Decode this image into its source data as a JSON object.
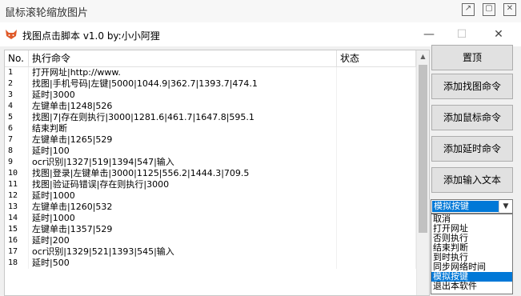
{
  "viewer": {
    "title": "鼠标滚轮缩放图片"
  },
  "window": {
    "title": "找图点击脚本 v1.0 by:小小阿狸",
    "controls": {
      "minimize": "—",
      "maximize": "☐",
      "close": "✕"
    }
  },
  "table": {
    "headers": [
      "No.",
      "执行命令",
      "状态"
    ],
    "rows": [
      {
        "no": "1",
        "cmd": "打开网址|http://www.                         ",
        "status": ""
      },
      {
        "no": "2",
        "cmd": "找图|手机号码|左键|5000|1044.9|362.7|1393.7|474.1",
        "status": ""
      },
      {
        "no": "3",
        "cmd": "延时|3000",
        "status": ""
      },
      {
        "no": "4",
        "cmd": "左键单击|1248|526",
        "status": ""
      },
      {
        "no": "5",
        "cmd": "找图|7|存在则执行|3000|1281.6|461.7|1647.8|595.1",
        "status": ""
      },
      {
        "no": "6",
        "cmd": "结束判断",
        "status": ""
      },
      {
        "no": "7",
        "cmd": "左键单击|1265|529",
        "status": ""
      },
      {
        "no": "8",
        "cmd": "延时|100",
        "status": ""
      },
      {
        "no": "9",
        "cmd": "ocr识别|1327|519|1394|547|输入",
        "status": ""
      },
      {
        "no": "10",
        "cmd": "找图|登录|左键单击|3000|1125|556.2|1444.3|709.5",
        "status": ""
      },
      {
        "no": "11",
        "cmd": "找图|验证码错误|存在则执行|3000",
        "status": ""
      },
      {
        "no": "12",
        "cmd": "延时|1000",
        "status": ""
      },
      {
        "no": "13",
        "cmd": "左键单击|1260|532",
        "status": ""
      },
      {
        "no": "14",
        "cmd": "延时|1000",
        "status": ""
      },
      {
        "no": "15",
        "cmd": "左键单击|1357|529",
        "status": ""
      },
      {
        "no": "16",
        "cmd": "延时|200",
        "status": ""
      },
      {
        "no": "17",
        "cmd": "ocr识别|1329|521|1393|545|输入",
        "status": ""
      },
      {
        "no": "18",
        "cmd": "延时|500",
        "status": ""
      }
    ]
  },
  "buttons": {
    "top": "置顶",
    "add_find_image": "添加找图命令",
    "add_mouse": "添加鼠标命令",
    "add_delay": "添加延时命令",
    "add_input": "添加输入文本"
  },
  "combo": {
    "selected": "模拟按键",
    "options": [
      "取消",
      "打开网址",
      "否则执行",
      "结束判断",
      "到时执行",
      "同步网络时间",
      "模拟按键",
      "退出本软件"
    ]
  }
}
